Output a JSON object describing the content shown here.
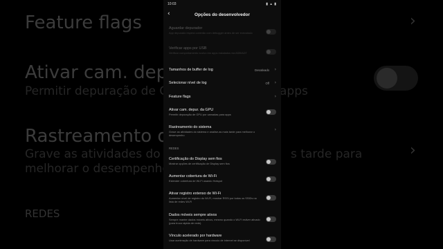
{
  "background": {
    "items": [
      {
        "title": "Feature flags"
      },
      {
        "title": "Ativar cam. depur. da",
        "subtitle": "Permitir depuração de GP"
      },
      {
        "title": "Rastreamento do sis",
        "subtitle": "Grave as atividades do sis"
      },
      {
        "subtitle_tail_1": "apps"
      },
      {
        "subtitle_tail_2": "s tarde para",
        "subtitle_line2": "melhorar o desempenho"
      }
    ],
    "section": "REDES"
  },
  "status_bar": {
    "time": "10:03",
    "icons": "▮ ▴ ▮"
  },
  "header": {
    "title": "Opções do desenvolvedor",
    "back_icon": "back-arrow-icon"
  },
  "rows": [
    {
      "title": "Aguardar depurador",
      "subtitle": "App depurado espera conexão com debugger antes de ser executado",
      "enabled": false,
      "toggle": false
    },
    {
      "title": "Verificar apps por USB",
      "subtitle": "Verificar comportamento nocivo em apps instalados via ADB/ADT",
      "enabled": false,
      "toggle": false
    },
    {
      "title": "Tamanhos de buffer de log",
      "value": "Desativado"
    },
    {
      "title": "Selecionar nível de log",
      "value": "Off"
    },
    {
      "title": "Feature flags"
    },
    {
      "title": "Ativar cam. depur. da GPU",
      "subtitle": "Permitir depuração de GPU por camadas para apps",
      "toggle": false
    },
    {
      "title": "Rastreamento do sistema",
      "subtitle": "Grave as atividades do sistema e analise-as mais tarde para melhorar o desempenho"
    }
  ],
  "section_label": "REDES",
  "network_rows": [
    {
      "title": "Certificação do Display sem fios",
      "subtitle": "Mostrar opções de certificação de Display sem fios",
      "toggle": false
    },
    {
      "title": "Aumentar cobertura de Wi-Fi",
      "subtitle": "Estender cobertura de Wi-Fi usando Hotspot",
      "toggle": false
    },
    {
      "title": "Ativar registro extenso de Wi-Fi",
      "subtitle": "Aumentar nível de registro do Wi-Fi, mostrar RSSI por todos os SSIDs na lista de redes Wi-Fi",
      "toggle": false
    },
    {
      "title": "Dados móveis sempre ativos",
      "subtitle": "Sempre manter dados móveis ativos, mesmo quando o Wi-Fi estiver ativado (para troca rápida de rede).",
      "toggle": false
    },
    {
      "title": "Vínculo acelerado por hardware",
      "subtitle": "Usar aceleração de hardware para vínculo de internet se disponível",
      "toggle": false
    }
  ]
}
